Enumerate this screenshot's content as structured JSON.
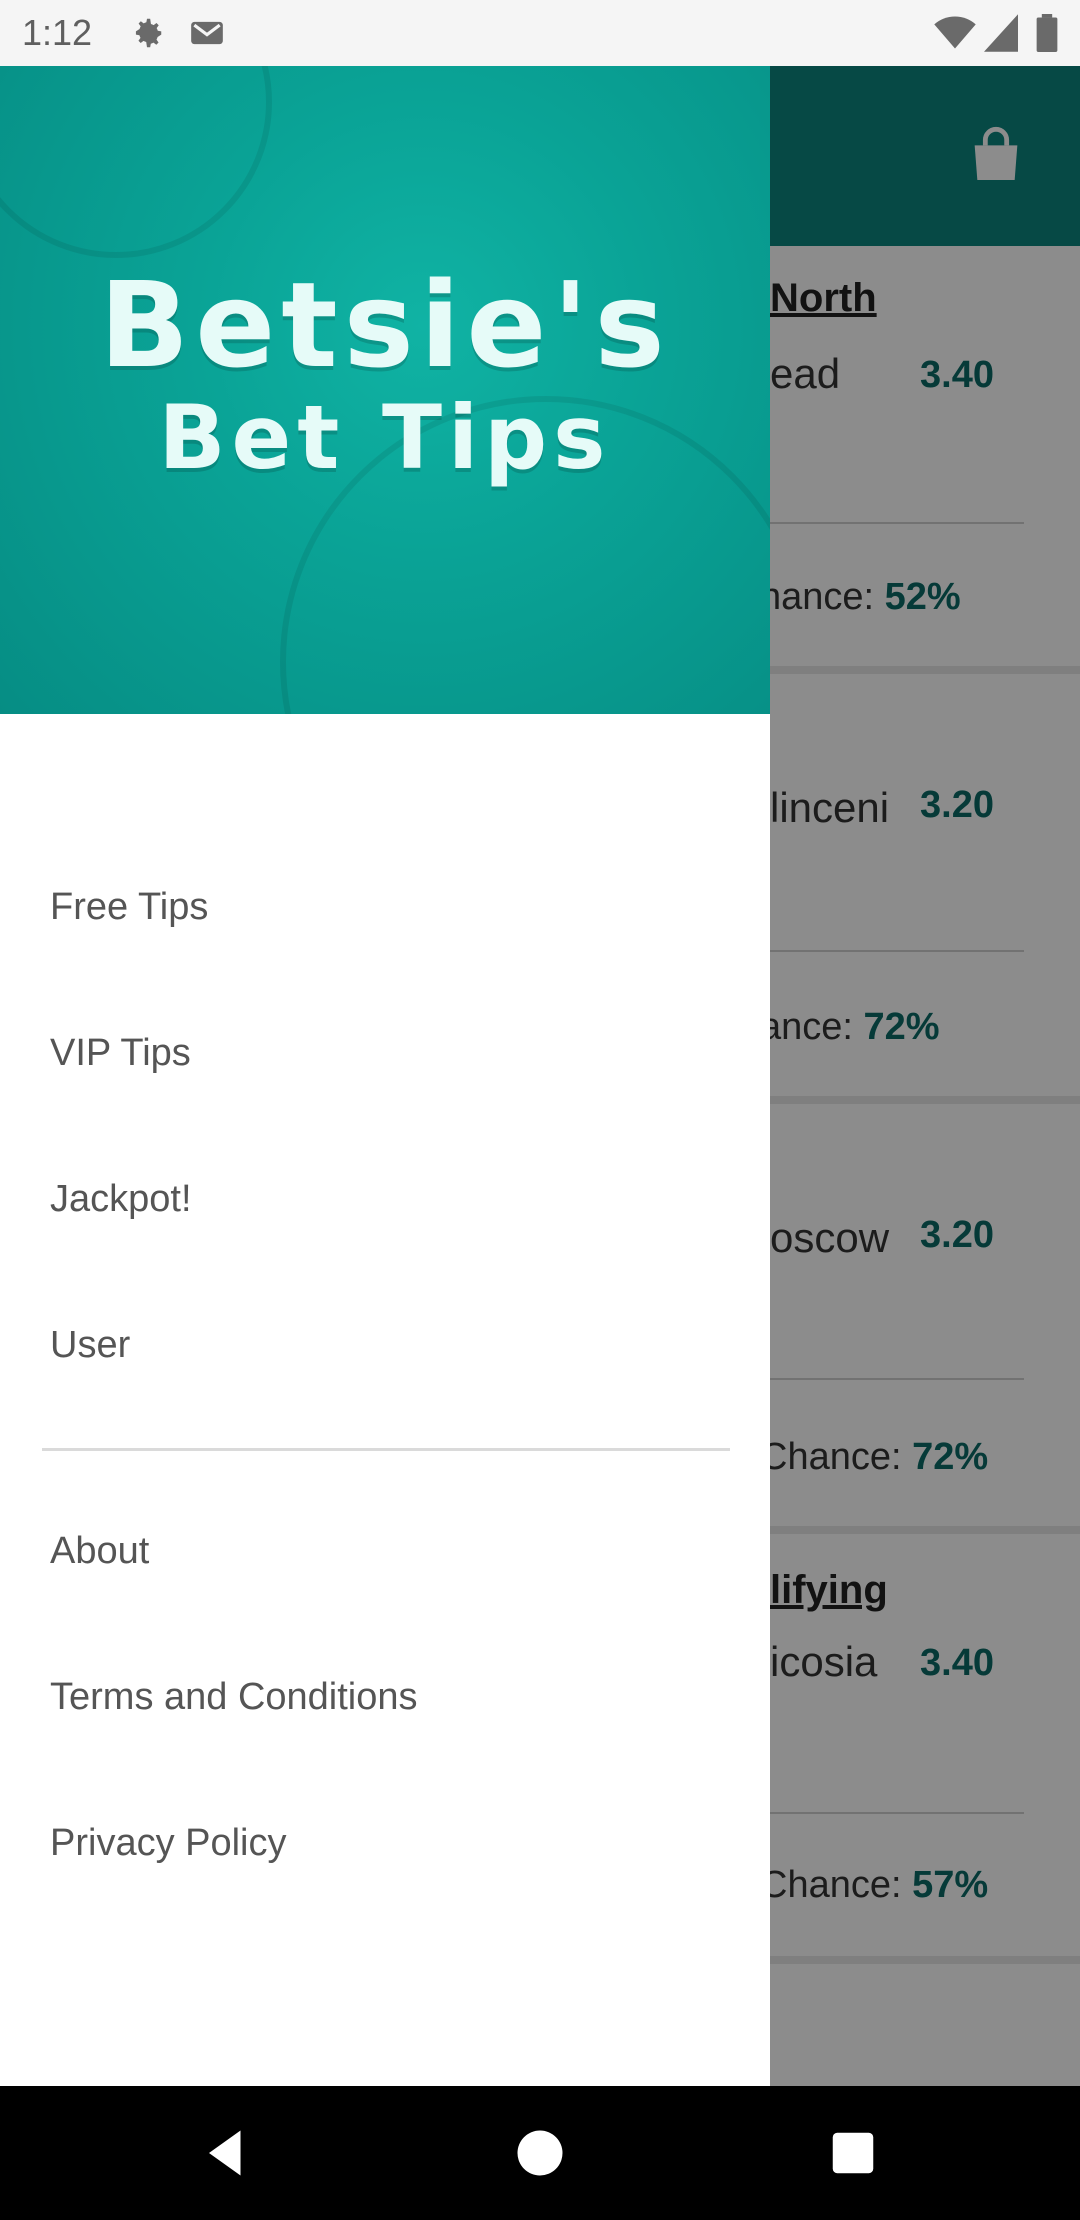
{
  "status_bar": {
    "time": "1:12",
    "icons_left": [
      "gear-icon",
      "gmail-icon"
    ],
    "icons_right": [
      "wifi-icon",
      "signal-icon",
      "battery-icon"
    ]
  },
  "app": {
    "bar_icon": "shopping-bag-icon",
    "cards": [
      {
        "league": "North",
        "team": "ead",
        "odds": "3.40",
        "chance_label": "hance: ",
        "chance_value": "52%"
      },
      {
        "league": "",
        "team": "linceni",
        "odds": "3.20",
        "chance_label": "ance: ",
        "chance_value": "72%"
      },
      {
        "league": "",
        "team": "oscow",
        "odds": "3.20",
        "chance_label": "Chance: ",
        "chance_value": "72%"
      },
      {
        "league": "lifying",
        "team": "icosia",
        "odds": "3.40",
        "chance_label": "Chance: ",
        "chance_value": "57%"
      }
    ]
  },
  "drawer": {
    "brand_line1": "Betsie's",
    "brand_line2": "Bet Tips",
    "menu_primary": [
      "Free Tips",
      "VIP Tips",
      "Jackpot!",
      "User"
    ],
    "menu_secondary": [
      "About",
      "Terms and Conditions",
      "Privacy Policy"
    ]
  },
  "colors": {
    "accent": "#0b857e",
    "header_teal": "#0aa396",
    "odds_text": "#0b6b66"
  }
}
